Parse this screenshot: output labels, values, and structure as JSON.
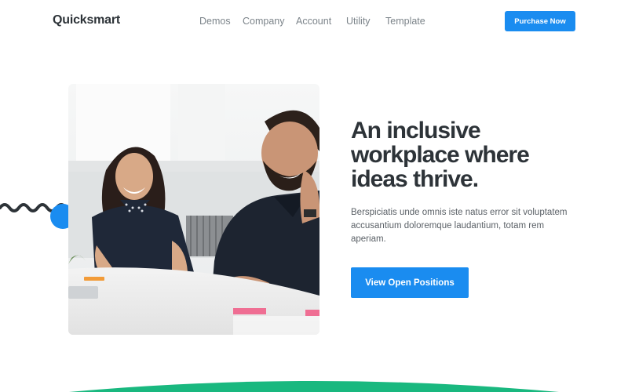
{
  "header": {
    "logo": "Quicksmart",
    "nav": [
      "Demos",
      "Company",
      "Account",
      "Utility",
      "Template"
    ],
    "purchase_label": "Purchase Now"
  },
  "hero": {
    "headline": "An inclusive workplace where ideas thrive.",
    "description": "Berspiciatis unde omnis iste natus error sit voluptatem accusantium doloremque laudantium, totam rem aperiam.",
    "cta_label": "View Open Positions"
  },
  "colors": {
    "accent": "#1a8cf0",
    "heading": "#2d3338",
    "body_text": "#5b6167",
    "nav_text": "#7c848a",
    "decoration_green": "#19b87f"
  },
  "icons": [
    "squiggle-decoration",
    "circle-decoration",
    "wave-decoration"
  ]
}
